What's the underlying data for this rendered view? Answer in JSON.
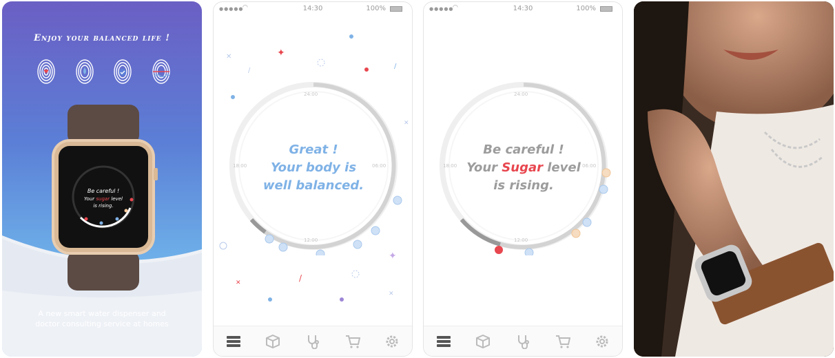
{
  "colors": {
    "accent_blue": "#7fb2e6",
    "warning_red": "#e8474f",
    "neutral_grey": "#9c9c9c",
    "dot_orange": "#f6c89a"
  },
  "intro": {
    "tagline": "Enjoy your balanced life !",
    "description_line1": "A new smart water dispenser and",
    "description_line2": "doctor consulting service at homes",
    "watch": {
      "line1": "Be careful !",
      "line2_pre": "Your",
      "line2_highlight": "sugar",
      "line2_post": "level",
      "line3": "is rising."
    },
    "icons": [
      "fingerprint-heart-icon",
      "fingerprint-drop-icon",
      "fingerprint-check-icon",
      "fingerprint-wave-icon"
    ]
  },
  "status_bar": {
    "signal": "●●●●●",
    "time": "14:30",
    "battery": "100%"
  },
  "dial": {
    "ticks": {
      "top": "24:00",
      "right": "06:00",
      "bottom": "12:00",
      "left": "18:00"
    }
  },
  "balanced_screen": {
    "line1": "Great !",
    "line2": "Your body is",
    "line3": "well balanced."
  },
  "careful_screen": {
    "line1": "Be careful !",
    "line2_pre": "Your",
    "line2_highlight": "Sugar",
    "line2_post": "level",
    "line3": "is rising."
  },
  "tabbar": {
    "items": [
      "menu-icon",
      "box-icon",
      "stethoscope-icon",
      "cart-icon",
      "gear-icon"
    ]
  }
}
